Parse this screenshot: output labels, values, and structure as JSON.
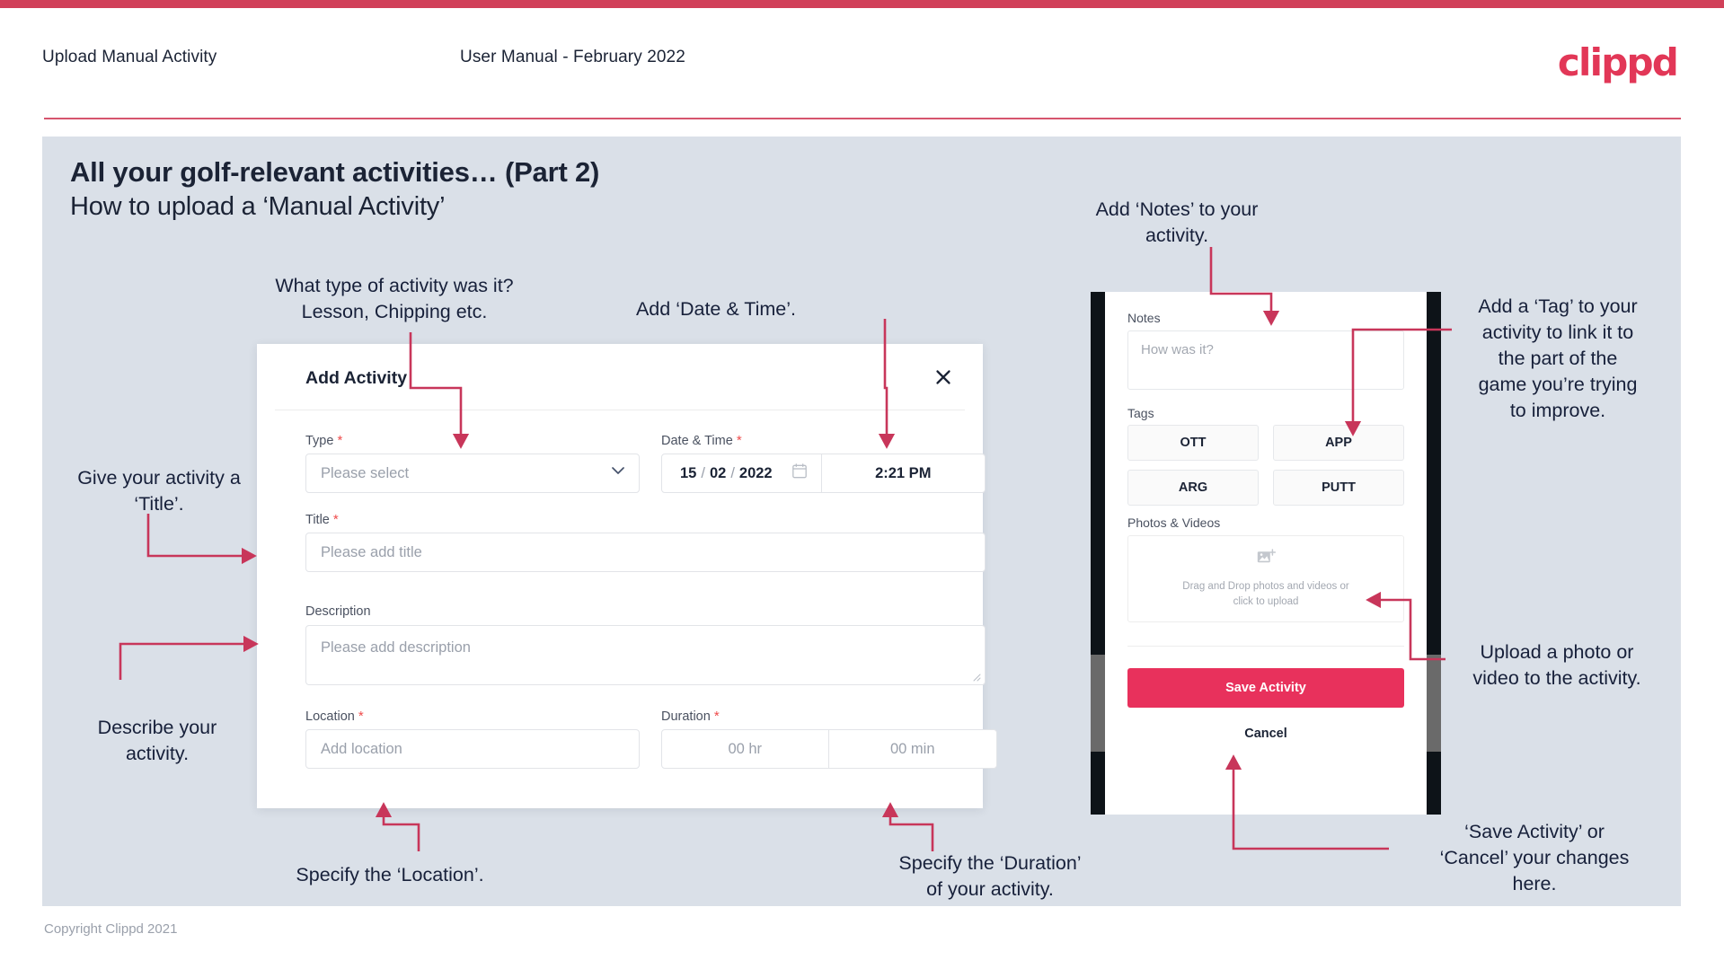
{
  "header": {
    "left_title": "Upload Manual Activity",
    "center_title": "User Manual - February 2022",
    "logo": "clippd"
  },
  "slide": {
    "title_main": "All your golf-relevant activities… (Part 2)",
    "title_sub": "How to upload a ‘Manual Activity’"
  },
  "annotations": {
    "type": "What type of activity was it?\nLesson, Chipping etc.",
    "datetime": "Add ‘Date & Time’.",
    "title": "Give your activity a\n‘Title’.",
    "description": "Describe your\nactivity.",
    "location": "Specify the ‘Location’.",
    "duration": "Specify the ‘Duration’\nof your activity.",
    "notes": "Add ‘Notes’ to your\nactivity.",
    "tags": "Add a ‘Tag’ to your\nactivity to link it to\nthe part of the\ngame you’re trying\nto improve.",
    "upload": "Upload a photo or\nvideo to the activity.",
    "save_cancel": "‘Save Activity’ or\n‘Cancel’ your changes\nhere."
  },
  "modal": {
    "title": "Add Activity",
    "close_icon": "close-icon",
    "fields": {
      "type": {
        "label": "Type",
        "required": "*",
        "placeholder": "Please select",
        "icon": "chevron-down-icon"
      },
      "datetime": {
        "label": "Date & Time",
        "required": "*",
        "day": "15",
        "month": "02",
        "year": "2022",
        "sep": "/",
        "time": "2:21 PM",
        "icon": "calendar-icon"
      },
      "title": {
        "label": "Title",
        "required": "*",
        "placeholder": "Please add title"
      },
      "description": {
        "label": "Description",
        "required": "",
        "placeholder": "Please add description"
      },
      "location": {
        "label": "Location",
        "required": "*",
        "placeholder": "Add location"
      },
      "duration": {
        "label": "Duration",
        "required": "*",
        "hours_placeholder": "00 hr",
        "minutes_placeholder": "00 min"
      }
    }
  },
  "phone": {
    "notes": {
      "label": "Notes",
      "placeholder": "How was it?"
    },
    "tags": {
      "label": "Tags",
      "items": [
        "OTT",
        "APP",
        "ARG",
        "PUTT"
      ]
    },
    "photos": {
      "label": "Photos & Videos",
      "dropzone_line1": "Drag and Drop photos and videos or",
      "dropzone_line2": "click to upload",
      "icon": "add-image-icon"
    },
    "save_label": "Save Activity",
    "cancel_label": "Cancel"
  },
  "footer": {
    "copyright": "Copyright Clippd 2021"
  },
  "colors": {
    "brand_red": "#e23757",
    "accent_bar": "#d14059",
    "save_button": "#e8315c",
    "slide_bg": "#dae0e8",
    "arrow": "#c8365a",
    "text_dark": "#1b2335"
  }
}
